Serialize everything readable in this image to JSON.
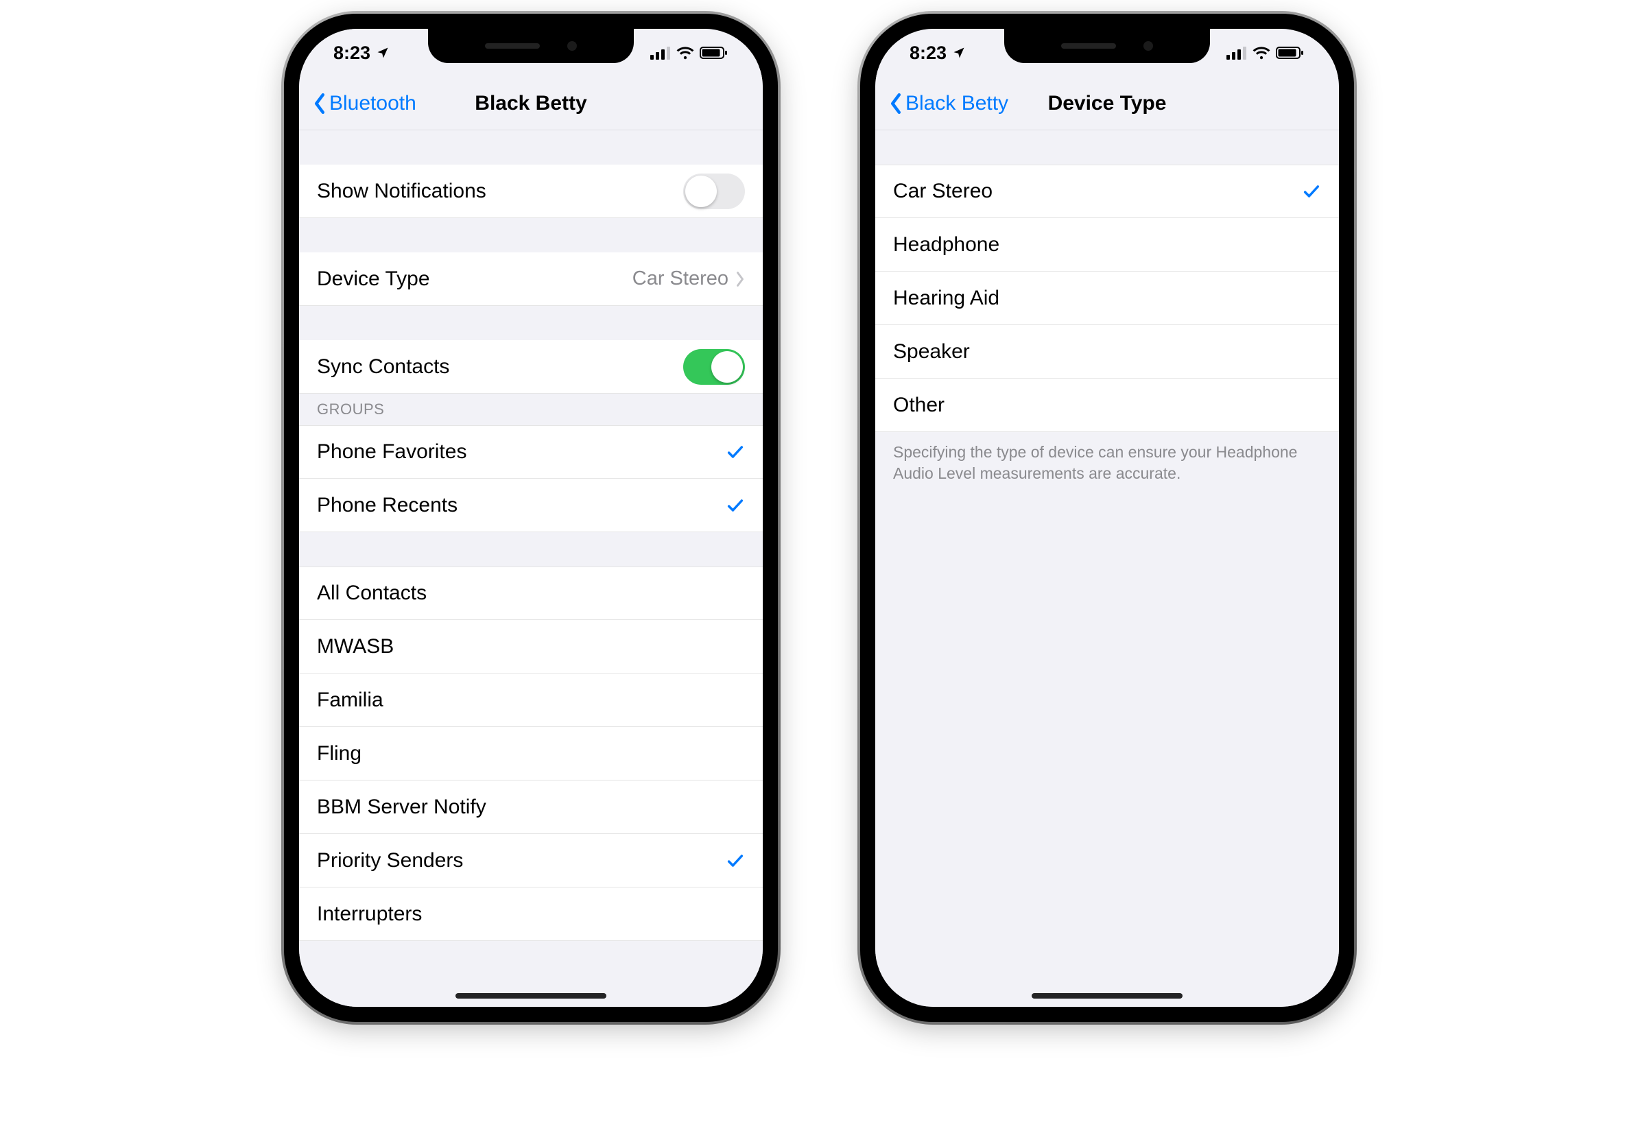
{
  "status": {
    "time": "8:23",
    "location_icon": "location-arrow"
  },
  "phone1": {
    "nav": {
      "back": "Bluetooth",
      "title": "Black Betty"
    },
    "row_show_notifications": {
      "label": "Show Notifications",
      "on": false
    },
    "row_device_type": {
      "label": "Device Type",
      "value": "Car Stereo"
    },
    "row_sync_contacts": {
      "label": "Sync Contacts",
      "on": true
    },
    "groups_header": "GROUPS",
    "groups_top": [
      {
        "label": "Phone Favorites",
        "checked": true
      },
      {
        "label": "Phone Recents",
        "checked": true
      }
    ],
    "groups_bottom": [
      {
        "label": "All Contacts",
        "checked": false
      },
      {
        "label": "MWASB",
        "checked": false
      },
      {
        "label": "Familia",
        "checked": false
      },
      {
        "label": "Fling",
        "checked": false
      },
      {
        "label": "BBM Server Notify",
        "checked": false
      },
      {
        "label": "Priority Senders",
        "checked": true
      },
      {
        "label": "Interrupters",
        "checked": false
      }
    ]
  },
  "phone2": {
    "nav": {
      "back": "Black Betty",
      "title": "Device Type"
    },
    "options": [
      {
        "label": "Car Stereo",
        "checked": true
      },
      {
        "label": "Headphone",
        "checked": false
      },
      {
        "label": "Hearing Aid",
        "checked": false
      },
      {
        "label": "Speaker",
        "checked": false
      },
      {
        "label": "Other",
        "checked": false
      }
    ],
    "footer": "Specifying the type of device can ensure your Headphone Audio Level measurements are accurate."
  }
}
